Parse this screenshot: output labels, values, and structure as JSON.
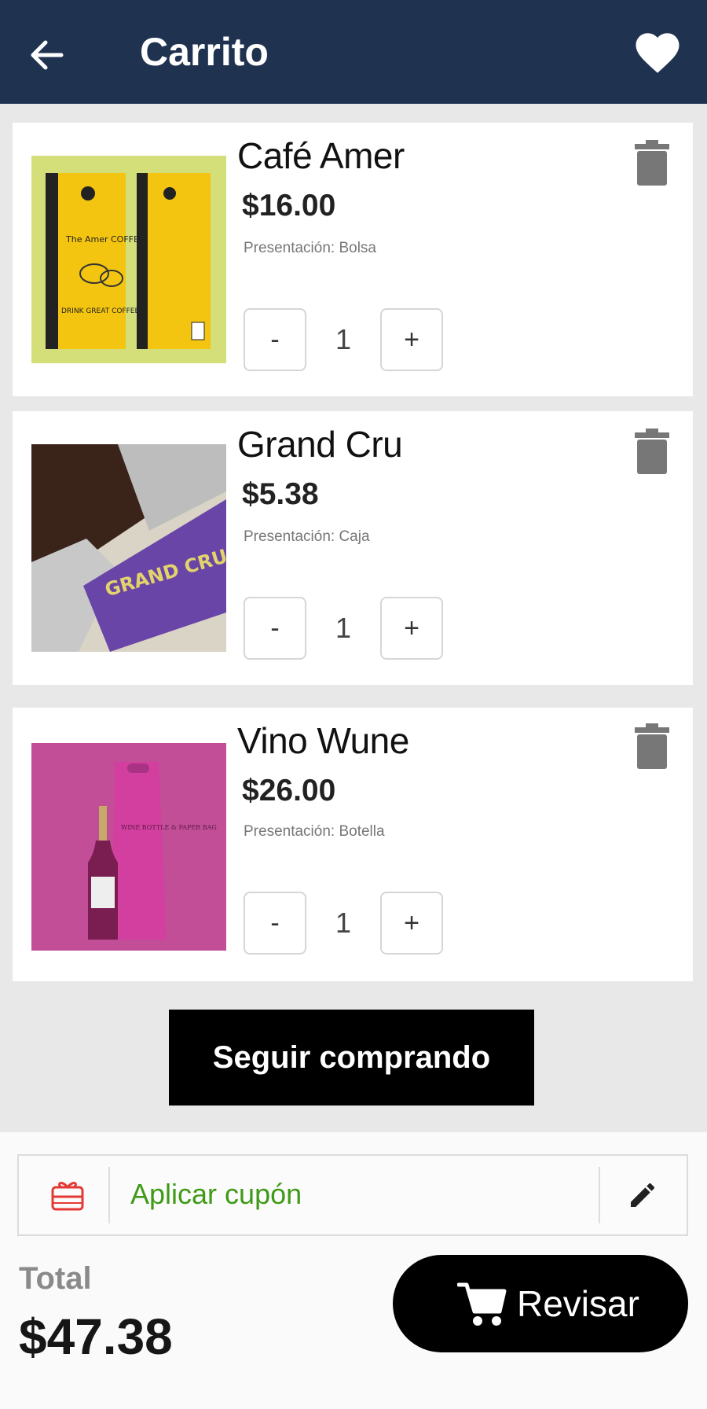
{
  "header": {
    "title": "Carrito",
    "back_icon": "arrow-left-icon",
    "favorite_icon": "heart-icon",
    "background": "#1f3350"
  },
  "cart_items": [
    {
      "name": "Café Amer",
      "price": "$16.00",
      "presentation": "Presentación: Bolsa",
      "quantity": "1",
      "minus_label": "-",
      "plus_label": "+",
      "image_icon": "coffee-bag-image",
      "image_text": "The Amer COFFEE",
      "image_text_back": "DRINK GREAT COFFEE"
    },
    {
      "name": "Grand Cru",
      "price": "$5.38",
      "presentation": "Presentación: Caja",
      "quantity": "1",
      "minus_label": "-",
      "plus_label": "+",
      "image_icon": "chocolate-box-image",
      "image_text": "GRAND CRU"
    },
    {
      "name": "Vino Wune",
      "price": "$26.00",
      "presentation": "Presentación: Botella",
      "quantity": "1",
      "minus_label": "-",
      "plus_label": "+",
      "image_icon": "wine-bottle-image",
      "image_text": "WINE BOTTLE & PAPER BAG"
    }
  ],
  "actions": {
    "continue_label": "Seguir comprando"
  },
  "coupon": {
    "label": "Aplicar cupón",
    "gift_icon": "gift-card-icon",
    "edit_icon": "pencil-icon",
    "label_color": "#3f9a17",
    "icon_color": "#e53935"
  },
  "summary": {
    "total_label": "Total",
    "total_value": "$47.38",
    "review_label": "Revisar",
    "cart_icon": "shopping-cart-icon"
  }
}
